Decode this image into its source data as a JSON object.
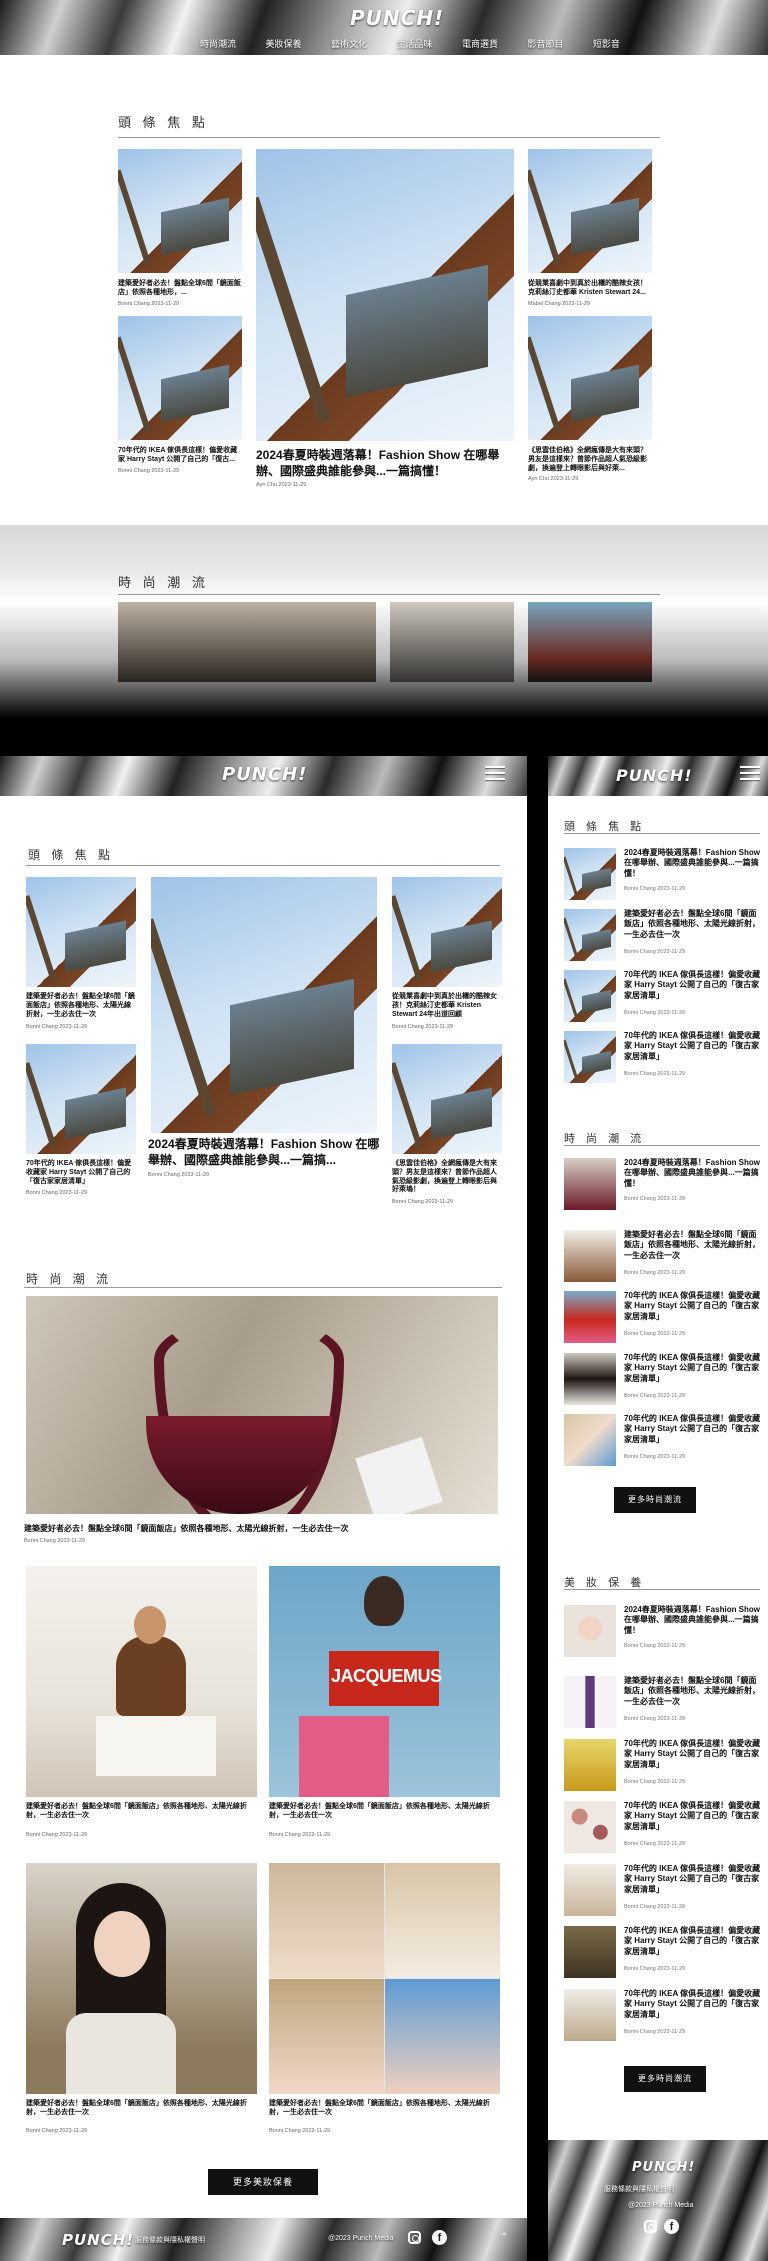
{
  "brand": {
    "logo": "PUNCH!"
  },
  "nav": {
    "items": [
      "時尚潮流",
      "美妝保養",
      "藝術文化",
      "生活品味",
      "電商選貨",
      "影音節目",
      "短影音"
    ]
  },
  "sections": {
    "headline": "頭 條 焦 點",
    "fashion": "時 尚 潮 流",
    "beauty": "美 妝 保 養"
  },
  "desktop": {
    "cards": [
      {
        "title": "建築愛好者必去！盤點全球6間「鏡面飯店」依照各種地形，...",
        "meta": "Bonni Chang 2023-11-29"
      },
      {
        "title": "70年代的 IKEA 傢俱長這樣！偏愛收藏家 Harry Stayt 公開了自己的「復古...",
        "meta": "Bonni Chang 2023-11-29"
      },
      {
        "title": "2024春夏時裝週落幕！Fashion Show 在哪舉辦、國際盛典誰能參與...一篇搞懂！",
        "meta": "Ayn Chu 2023-11-29"
      },
      {
        "title": "從競業喜劇中到真於出櫃的酷辣女孩！克莉絲汀史都華 Kristen Stewart 24...",
        "meta": "Mabel Chang 2023-11-29"
      },
      {
        "title": "《思雲佳伯格》全網瘋傳是大有來頭？男友是這樣來？曾節作品超人氣恐級影劇，換遍登上轉眼影后與好萊...",
        "meta": "Ayn Chu 2023-11-29"
      }
    ]
  },
  "tablet": {
    "cards": [
      {
        "title": "建築愛好者必去！盤點全球6間「鏡面飯店」依照各種地形、太陽光線折射，一生必去住一次",
        "meta": "Bonni Chang 2023-11-29"
      },
      {
        "title": "70年代的 IKEA 傢俱長這樣！偏愛收藏家 Harry Stayt 公開了自己的「復古家家居清單」",
        "meta": "Bonni Chang 2023-11-29"
      },
      {
        "title": "2024春夏時裝週落幕！Fashion Show 在哪舉辦、國際盛典誰能參與...一篇搞...",
        "meta": "Bonni Chang 2023-11-29"
      },
      {
        "title": "從競業喜劇中到真於出櫃的酷辣女孩！克莉絲汀史都華 Kristen Stewart 24年出道回顧",
        "meta": "Bonni Chang 2023-11-29"
      },
      {
        "title": "《思雲佳伯格》全網瘋傳是大有來頭？男友是這樣來？曾節作品超人氣恐級影劇，換遍登上轉眼影后與好萊塢！",
        "meta": "Bonni Chang 2023-11-29"
      }
    ],
    "fashion_main": {
      "title": "建築愛好者必去！盤點全球6間「鏡面飯店」依照各種地形、太陽光線折射，一生必去住一次",
      "meta": "Bonni Chang 2023-11-29"
    },
    "fashion_grid": [
      {
        "title": "建築愛好者必去！盤點全球6間「鏡面飯店」依照各種地形、太陽光線折射，一生必去住一次",
        "meta": "Bonni Chang 2023-11-29"
      },
      {
        "title": "建築愛好者必去！盤點全球6間「鏡面飯店」依照各種地形、太陽光線折射，一生必去住一次",
        "meta": "Bonni Chang 2023-11-29"
      },
      {
        "title": "建築愛好者必去！盤點全球6間「鏡面飯店」依照各種地形、太陽光線折射，一生必去住一次",
        "meta": "Bonni Chang 2023-11-29"
      },
      {
        "title": "建築愛好者必去！盤點全球6間「鏡面飯店」依照各種地形、太陽光線折射，一生必去住一次",
        "meta": "Bonni Chang 2023-11-29"
      }
    ],
    "jacquemus": "JACQUEMUS",
    "more_button": "更多美妝保養",
    "footer": {
      "link": "服務條款與隱私權聲明",
      "copyright": "@2023 Punch Media"
    }
  },
  "mobile": {
    "headline": [
      {
        "title": "2024春夏時裝週落幕！Fashion Show 在哪舉辦、國際盛典誰能參與...一篇搞懂！",
        "meta": "Bonni Chang 2023-11-29"
      },
      {
        "title": "建築愛好者必去！盤點全球6間「鏡面飯店」依照各種地形、太陽光線折射，一生必去住一次",
        "meta": "Bonni Chang 2023-11-29"
      },
      {
        "title": "70年代的 IKEA 傢俱長這樣！偏愛收藏家 Harry Stayt 公開了自己的「復古家家居清單」",
        "meta": "Bonni Chang 2023-11-29"
      },
      {
        "title": "70年代的 IKEA 傢俱長這樣！偏愛收藏家 Harry Stayt 公開了自己的「復古家家居清單」",
        "meta": "Bonni Chang 2023-11-29"
      }
    ],
    "fashion": [
      {
        "title": "2024春夏時裝週落幕！Fashion Show 在哪舉辦、國際盛典誰能參與...一篇搞懂！",
        "meta": "Bonni Chang 2023-11-29"
      },
      {
        "title": "建築愛好者必去！盤點全球6間「鏡面飯店」依照各種地形、太陽光線折射，一生必去住一次",
        "meta": "Bonni Chang 2023-11-29"
      },
      {
        "title": "70年代的 IKEA 傢俱長這樣！偏愛收藏家 Harry Stayt 公開了自己的「復古家家居清單」",
        "meta": "Bonni Chang 2023-11-29"
      },
      {
        "title": "70年代的 IKEA 傢俱長這樣！偏愛收藏家 Harry Stayt 公開了自己的「復古家家居清單」",
        "meta": "Bonni Chang 2023-11-29"
      },
      {
        "title": "70年代的 IKEA 傢俱長這樣！偏愛收藏家 Harry Stayt 公開了自己的「復古家家居清單」",
        "meta": "Bonni Chang 2023-11-29"
      }
    ],
    "fashion_button": "更多時尚潮流",
    "beauty": [
      {
        "title": "2024春夏時裝週落幕！Fashion Show 在哪舉辦、國際盛典誰能參與...一篇搞懂！",
        "meta": "Bonni Chang 2023-11-29"
      },
      {
        "title": "建築愛好者必去！盤點全球6間「鏡面飯店」依照各種地形、太陽光線折射，一生必去住一次",
        "meta": "Bonni Chang 2023-11-29"
      },
      {
        "title": "70年代的 IKEA 傢俱長這樣！偏愛收藏家 Harry Stayt 公開了自己的「復古家家居清單」",
        "meta": "Bonni Chang 2023-11-29"
      },
      {
        "title": "70年代的 IKEA 傢俱長這樣！偏愛收藏家 Harry Stayt 公開了自己的「復古家家居清單」",
        "meta": "Bonni Chang 2023-11-29"
      },
      {
        "title": "70年代的 IKEA 傢俱長這樣！偏愛收藏家 Harry Stayt 公開了自己的「復古家家居清單」",
        "meta": "Bonni Chang 2023-11-29"
      },
      {
        "title": "70年代的 IKEA 傢俱長這樣！偏愛收藏家 Harry Stayt 公開了自己的「復古家家居清單」",
        "meta": "Bonni Chang 2023-11-29"
      },
      {
        "title": "70年代的 IKEA 傢俱長這樣！偏愛收藏家 Harry Stayt 公開了自己的「復古家家居清單」",
        "meta": "Bonni Chang 2023-11-29"
      }
    ],
    "beauty_button": "更多時尚潮流",
    "footer": {
      "link": "服務條款與隱私權聲明",
      "copyright": "@2023 Punch Media"
    }
  },
  "icons": {
    "instagram": "instagram-icon",
    "facebook": "facebook-icon",
    "menu": "menu-icon",
    "up": "chevron-up-icon"
  }
}
